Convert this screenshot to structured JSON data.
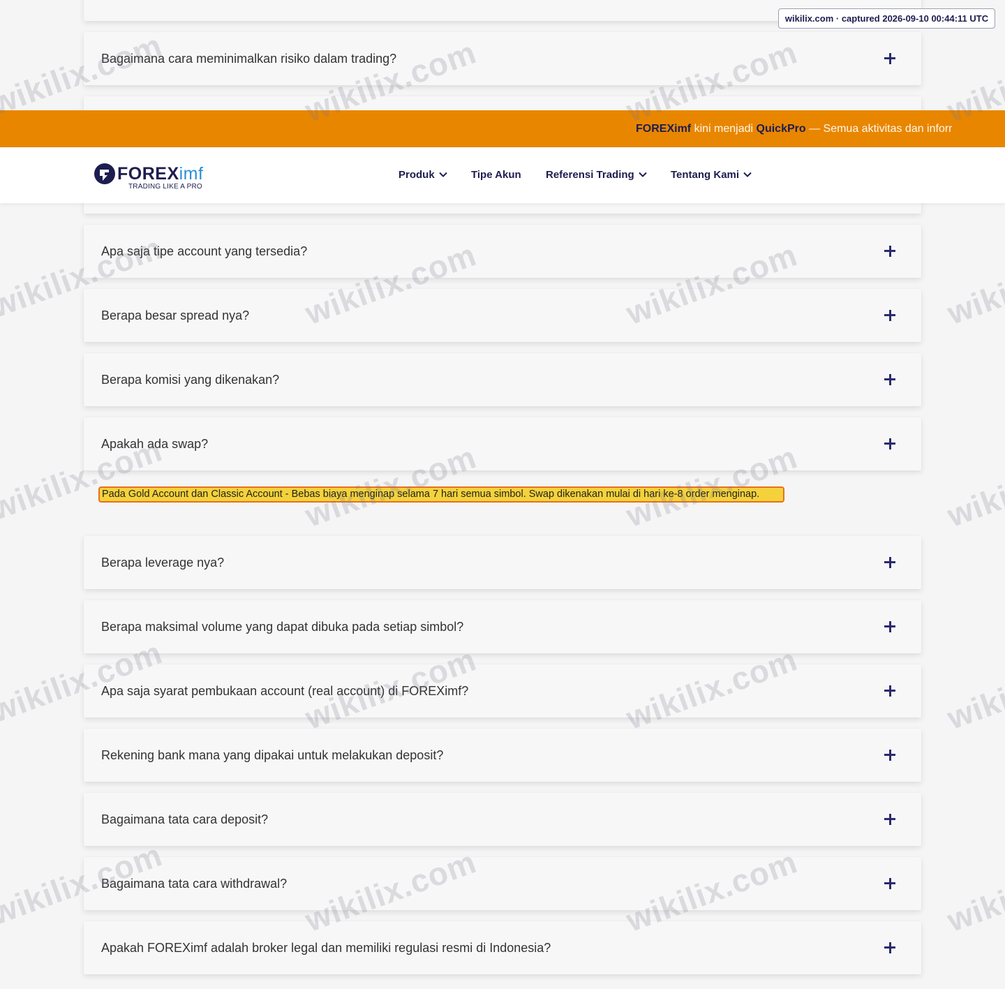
{
  "banner": {
    "brand_old": "FOREXimf",
    "text_1": " kini menjadi ",
    "brand_new": "QuickPro",
    "text_2": " — Semua aktivitas dan inforr"
  },
  "header": {
    "logo": {
      "word_main": "FOREX",
      "word_suffix": "imf",
      "tagline": "TRADING LIKE A PRO"
    },
    "nav": [
      {
        "label": "Produk",
        "icon": "chevron-down-icon"
      },
      {
        "label": "Tipe Akun"
      },
      {
        "label": "Referensi Trading",
        "icon": "chevron-down-icon"
      },
      {
        "label": "Tentang Kami",
        "icon": "chevron-down-icon"
      }
    ]
  },
  "faq": {
    "items": [
      {
        "question": "Bagaimana cara meminimalkan risiko dalam trading?"
      },
      {
        "question": "Apa saja tipe account yang tersedia?"
      },
      {
        "question": "Berapa besar spread nya?"
      },
      {
        "question": "Berapa komisi yang dikenakan?"
      },
      {
        "question": "Apakah ada swap?",
        "expanded": true
      },
      {
        "question": "Berapa leverage nya?"
      },
      {
        "question": "Berapa maksimal volume yang dapat dibuka pada setiap simbol?"
      },
      {
        "question": "Apa saja syarat pembukaan account (real account) di FOREXimf?"
      },
      {
        "question": "Rekening bank mana yang dipakai untuk melakukan deposit?"
      },
      {
        "question": "Bagaimana tata cara deposit?"
      },
      {
        "question": "Bagaimana tata cara withdrawal?"
      },
      {
        "question": "Apakah FOREXimf adalah broker legal dan memiliki regulasi resmi di Indonesia?"
      }
    ],
    "swap_answer": "Pada Gold Account dan Classic Account - Bebas biaya menginap selama 7 hari semua simbol. Swap dikenakan mulai di hari ke-8 order menginap.",
    "expand_icon": "plus-icon"
  },
  "stamp": "wikilix.com · captured 2026-09-10 00:44:11 UTC",
  "watermark": "wikilix.com",
  "colors": {
    "banner": "#e98600",
    "navy": "#1d1d4f",
    "highlight_fill": "#f5d23b",
    "highlight_border": "#e8701f"
  }
}
